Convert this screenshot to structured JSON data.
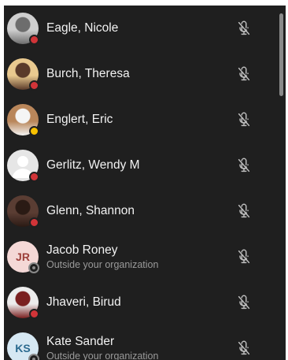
{
  "participants": [
    {
      "name": "Eagle, Nicole",
      "subtitle": "",
      "initials": "",
      "status": "busy",
      "status_color": "#d13438",
      "avatar_style": "photo",
      "avatar_colors": [
        "#cfcfcf",
        "#6d6d6d"
      ],
      "muted": true
    },
    {
      "name": "Burch, Theresa",
      "subtitle": "",
      "initials": "",
      "status": "busy",
      "status_color": "#d13438",
      "avatar_style": "photo",
      "avatar_colors": [
        "#e9c98f",
        "#5a3a2a"
      ],
      "muted": true
    },
    {
      "name": "Englert, Eric",
      "subtitle": "",
      "initials": "",
      "status": "away",
      "status_color": "#f8c100",
      "avatar_style": "photo",
      "avatar_colors": [
        "#b9865a",
        "#f5f5f5"
      ],
      "muted": true
    },
    {
      "name": "Gerlitz, Wendy M",
      "subtitle": "",
      "initials": "",
      "status": "busy",
      "status_color": "#d13438",
      "avatar_style": "placeholder",
      "avatar_colors": [
        "#e6e6e6",
        "#ffffff"
      ],
      "muted": true
    },
    {
      "name": "Glenn, Shannon",
      "subtitle": "",
      "initials": "",
      "status": "busy",
      "status_color": "#d13438",
      "avatar_style": "photo",
      "avatar_colors": [
        "#5a3d33",
        "#2a1a14"
      ],
      "muted": true
    },
    {
      "name": "Jacob Roney",
      "subtitle": "Outside your organization",
      "initials": "JR",
      "status": "external",
      "status_color": "#8a8a8a",
      "avatar_style": "initials",
      "avatar_colors": [
        "#f4d8d6",
        "#9c3f3a"
      ],
      "muted": true
    },
    {
      "name": "Jhaveri, Birud",
      "subtitle": "",
      "initials": "",
      "status": "busy",
      "status_color": "#d13438",
      "avatar_style": "photo",
      "avatar_colors": [
        "#ececec",
        "#7a1f1f"
      ],
      "muted": true
    },
    {
      "name": "Kate Sander",
      "subtitle": "Outside your organization",
      "initials": "KS",
      "status": "external",
      "status_color": "#8a8a8a",
      "avatar_style": "initials",
      "avatar_colors": [
        "#d6e8f3",
        "#2b6a8f"
      ],
      "muted": true
    }
  ],
  "icons": {
    "mute": "mic-off-icon"
  },
  "colors": {
    "background": "#1f1f1f",
    "text": "#f2f2f2",
    "subtext": "#9a9a9a",
    "icon": "#bdbdbd"
  }
}
